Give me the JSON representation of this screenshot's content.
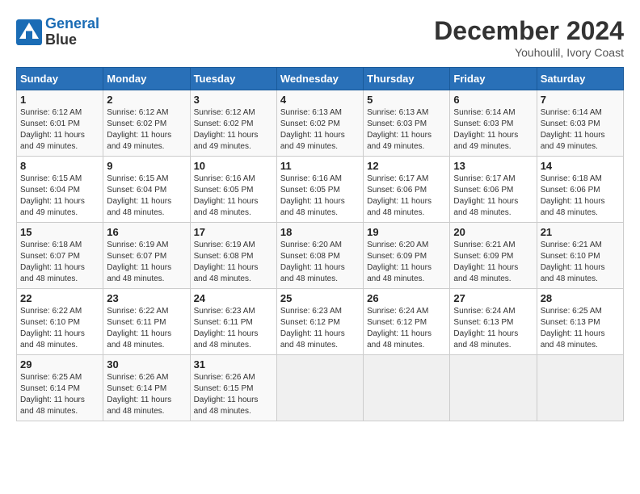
{
  "header": {
    "logo_line1": "General",
    "logo_line2": "Blue",
    "month_year": "December 2024",
    "location": "Youhoulil, Ivory Coast"
  },
  "weekdays": [
    "Sunday",
    "Monday",
    "Tuesday",
    "Wednesday",
    "Thursday",
    "Friday",
    "Saturday"
  ],
  "weeks": [
    [
      {
        "day": "1",
        "sunrise": "6:12 AM",
        "sunset": "6:01 PM",
        "daylight": "11 hours and 49 minutes."
      },
      {
        "day": "2",
        "sunrise": "6:12 AM",
        "sunset": "6:02 PM",
        "daylight": "11 hours and 49 minutes."
      },
      {
        "day": "3",
        "sunrise": "6:12 AM",
        "sunset": "6:02 PM",
        "daylight": "11 hours and 49 minutes."
      },
      {
        "day": "4",
        "sunrise": "6:13 AM",
        "sunset": "6:02 PM",
        "daylight": "11 hours and 49 minutes."
      },
      {
        "day": "5",
        "sunrise": "6:13 AM",
        "sunset": "6:03 PM",
        "daylight": "11 hours and 49 minutes."
      },
      {
        "day": "6",
        "sunrise": "6:14 AM",
        "sunset": "6:03 PM",
        "daylight": "11 hours and 49 minutes."
      },
      {
        "day": "7",
        "sunrise": "6:14 AM",
        "sunset": "6:03 PM",
        "daylight": "11 hours and 49 minutes."
      }
    ],
    [
      {
        "day": "8",
        "sunrise": "6:15 AM",
        "sunset": "6:04 PM",
        "daylight": "11 hours and 49 minutes."
      },
      {
        "day": "9",
        "sunrise": "6:15 AM",
        "sunset": "6:04 PM",
        "daylight": "11 hours and 48 minutes."
      },
      {
        "day": "10",
        "sunrise": "6:16 AM",
        "sunset": "6:05 PM",
        "daylight": "11 hours and 48 minutes."
      },
      {
        "day": "11",
        "sunrise": "6:16 AM",
        "sunset": "6:05 PM",
        "daylight": "11 hours and 48 minutes."
      },
      {
        "day": "12",
        "sunrise": "6:17 AM",
        "sunset": "6:06 PM",
        "daylight": "11 hours and 48 minutes."
      },
      {
        "day": "13",
        "sunrise": "6:17 AM",
        "sunset": "6:06 PM",
        "daylight": "11 hours and 48 minutes."
      },
      {
        "day": "14",
        "sunrise": "6:18 AM",
        "sunset": "6:06 PM",
        "daylight": "11 hours and 48 minutes."
      }
    ],
    [
      {
        "day": "15",
        "sunrise": "6:18 AM",
        "sunset": "6:07 PM",
        "daylight": "11 hours and 48 minutes."
      },
      {
        "day": "16",
        "sunrise": "6:19 AM",
        "sunset": "6:07 PM",
        "daylight": "11 hours and 48 minutes."
      },
      {
        "day": "17",
        "sunrise": "6:19 AM",
        "sunset": "6:08 PM",
        "daylight": "11 hours and 48 minutes."
      },
      {
        "day": "18",
        "sunrise": "6:20 AM",
        "sunset": "6:08 PM",
        "daylight": "11 hours and 48 minutes."
      },
      {
        "day": "19",
        "sunrise": "6:20 AM",
        "sunset": "6:09 PM",
        "daylight": "11 hours and 48 minutes."
      },
      {
        "day": "20",
        "sunrise": "6:21 AM",
        "sunset": "6:09 PM",
        "daylight": "11 hours and 48 minutes."
      },
      {
        "day": "21",
        "sunrise": "6:21 AM",
        "sunset": "6:10 PM",
        "daylight": "11 hours and 48 minutes."
      }
    ],
    [
      {
        "day": "22",
        "sunrise": "6:22 AM",
        "sunset": "6:10 PM",
        "daylight": "11 hours and 48 minutes."
      },
      {
        "day": "23",
        "sunrise": "6:22 AM",
        "sunset": "6:11 PM",
        "daylight": "11 hours and 48 minutes."
      },
      {
        "day": "24",
        "sunrise": "6:23 AM",
        "sunset": "6:11 PM",
        "daylight": "11 hours and 48 minutes."
      },
      {
        "day": "25",
        "sunrise": "6:23 AM",
        "sunset": "6:12 PM",
        "daylight": "11 hours and 48 minutes."
      },
      {
        "day": "26",
        "sunrise": "6:24 AM",
        "sunset": "6:12 PM",
        "daylight": "11 hours and 48 minutes."
      },
      {
        "day": "27",
        "sunrise": "6:24 AM",
        "sunset": "6:13 PM",
        "daylight": "11 hours and 48 minutes."
      },
      {
        "day": "28",
        "sunrise": "6:25 AM",
        "sunset": "6:13 PM",
        "daylight": "11 hours and 48 minutes."
      }
    ],
    [
      {
        "day": "29",
        "sunrise": "6:25 AM",
        "sunset": "6:14 PM",
        "daylight": "11 hours and 48 minutes."
      },
      {
        "day": "30",
        "sunrise": "6:26 AM",
        "sunset": "6:14 PM",
        "daylight": "11 hours and 48 minutes."
      },
      {
        "day": "31",
        "sunrise": "6:26 AM",
        "sunset": "6:15 PM",
        "daylight": "11 hours and 48 minutes."
      },
      null,
      null,
      null,
      null
    ]
  ],
  "labels": {
    "sunrise": "Sunrise: ",
    "sunset": "Sunset: ",
    "daylight": "Daylight: "
  }
}
